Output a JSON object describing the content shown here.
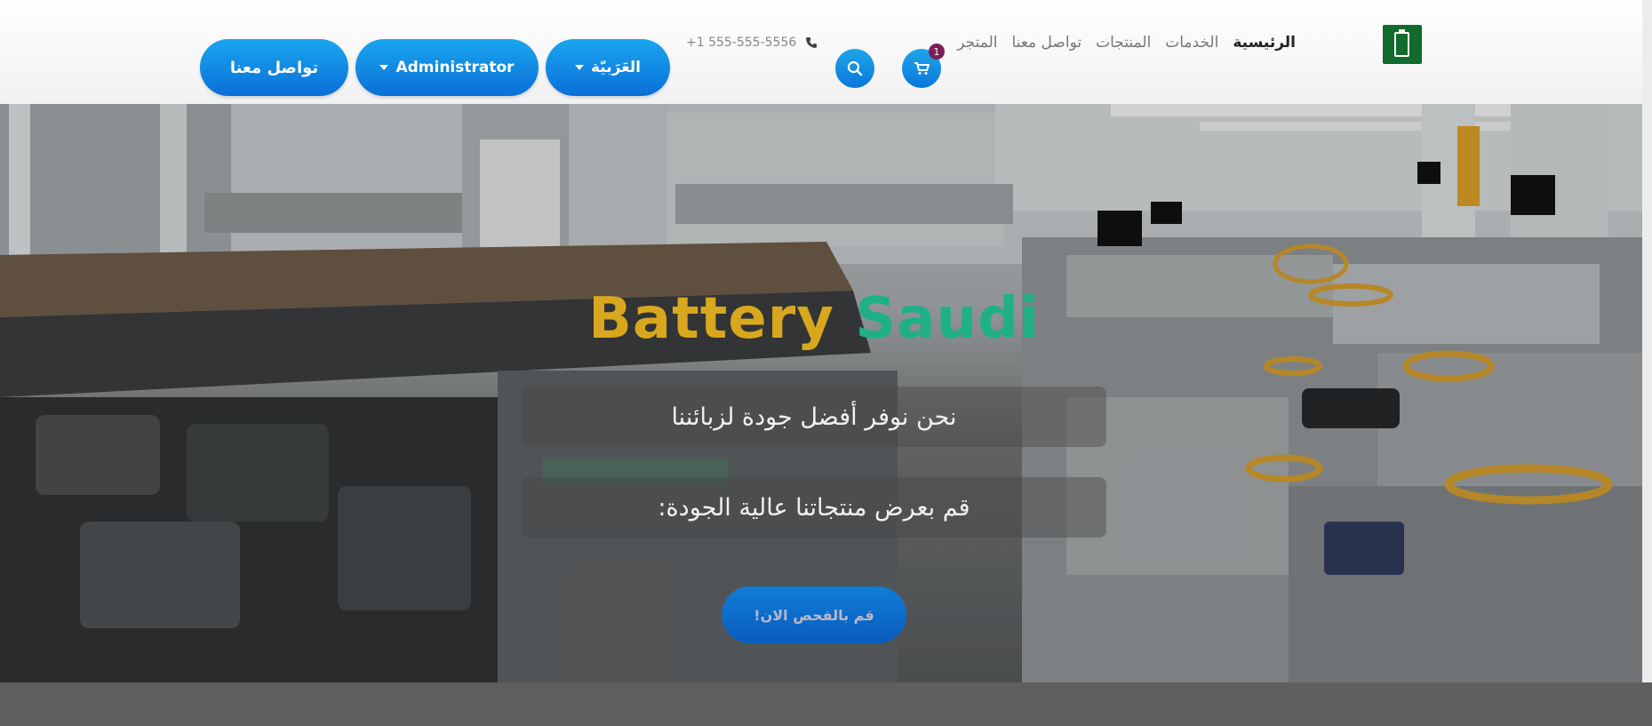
{
  "header": {
    "nav": [
      {
        "label": "الرئيسية",
        "active": true
      },
      {
        "label": "الخدمات",
        "active": false
      },
      {
        "label": "المنتجات",
        "active": false
      },
      {
        "label": "تواصل معنا",
        "active": false
      },
      {
        "label": "المتجر",
        "active": false
      }
    ],
    "cart_count": "1",
    "phone": "+1 555-555-5556",
    "language_label": "العَرَبيّة",
    "user_label": "Administrator",
    "contact_label": "تواصل معنا"
  },
  "hero": {
    "title_word1": "Battery",
    "title_word2": "Saudi",
    "caption1": "نحن نوفر أفضل جودة لزبائننا",
    "caption2": "قم بعرض منتجاتنا عالية الجودة:",
    "cta_label": "قم بالفحص الان!"
  },
  "colors": {
    "primary": "#0a76d9",
    "logo_green": "#116b2c",
    "title_gold": "#d8a71d",
    "title_green": "#1fb087",
    "badge": "#7a1f56"
  },
  "icons": [
    "logo-icon",
    "search-icon",
    "cart-icon",
    "phone-icon",
    "caret-down-icon"
  ]
}
